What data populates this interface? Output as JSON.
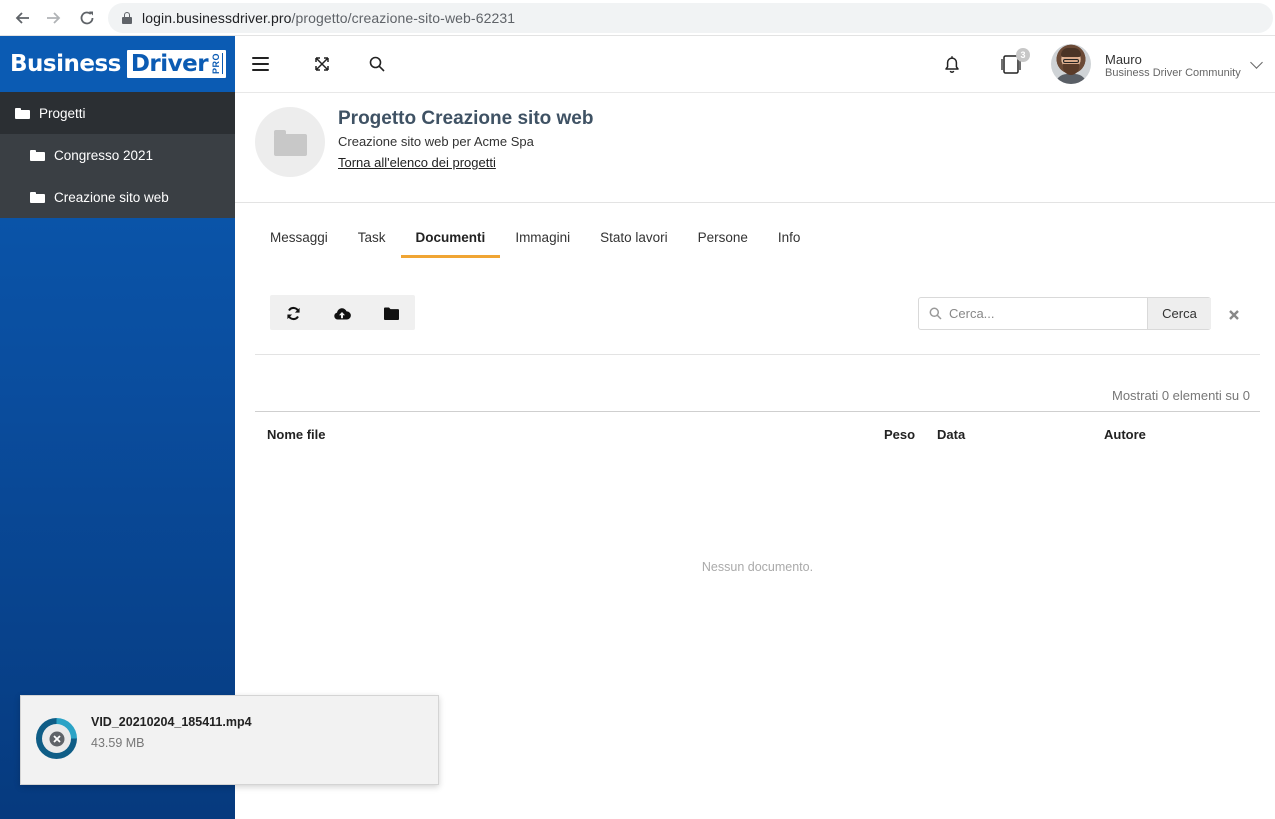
{
  "browser": {
    "url_host": "login.businessdriver.pro",
    "url_path": "/progetto/creazione-sito-web-62231"
  },
  "brand": {
    "part1": "Business",
    "part2": "Driver",
    "pro": "PRO"
  },
  "sidebar": {
    "items": [
      {
        "label": "Progetti",
        "level": 0
      },
      {
        "label": "Congresso 2021",
        "level": 1
      },
      {
        "label": "Creazione sito web",
        "level": 1
      }
    ]
  },
  "topbar": {
    "notification_count": "3",
    "user_name": "Mauro",
    "user_org": "Business Driver Community"
  },
  "project": {
    "title": "Progetto Creazione sito web",
    "subtitle": "Creazione sito web per Acme Spa",
    "back_link": "Torna all'elenco dei progetti"
  },
  "tabs": [
    {
      "label": "Messaggi",
      "active": false
    },
    {
      "label": "Task",
      "active": false
    },
    {
      "label": "Documenti",
      "active": true
    },
    {
      "label": "Immagini",
      "active": false
    },
    {
      "label": "Stato lavori",
      "active": false
    },
    {
      "label": "Persone",
      "active": false
    },
    {
      "label": "Info",
      "active": false
    }
  ],
  "toolbar": {
    "buttons": [
      "refresh-icon",
      "cloud-upload-icon",
      "folder-icon"
    ]
  },
  "search": {
    "placeholder": "Cerca...",
    "value": "",
    "button_label": "Cerca"
  },
  "documents": {
    "count_text": "Mostrati 0 elementi su 0",
    "columns": [
      "Nome file",
      "Peso",
      "Data",
      "Autore"
    ],
    "rows": [],
    "empty_message": "Nessun documento."
  },
  "download": {
    "filename": "VID_20210204_185411.mp4",
    "size": "43.59 MB"
  },
  "colors": {
    "brand_blue": "#0b5bb3",
    "tab_accent": "#f0a534",
    "title_color": "#3f5264"
  }
}
